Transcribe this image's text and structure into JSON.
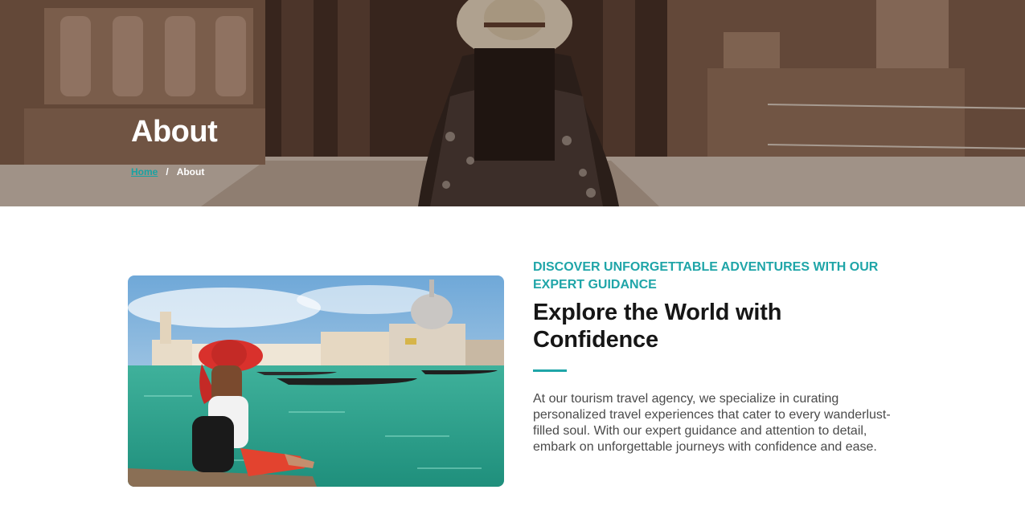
{
  "hero": {
    "title": "About",
    "breadcrumb": {
      "home": "Home",
      "separator": "/",
      "current": "About"
    }
  },
  "about": {
    "eyebrow": "DISCOVER UNFORGETTABLE ADVENTURES WITH OUR EXPERT GUIDANCE",
    "heading": "Explore the World with Confidence",
    "body": "At our tourism travel agency, we specialize in curating personalized travel experiences that cater to every wanderlust-filled soul. With our expert guidance and attention to detail, embark on unforgettable journeys with confidence and ease."
  },
  "colors": {
    "accent": "#1fa5a8",
    "heading": "#161616",
    "body": "#4a4a4a"
  }
}
